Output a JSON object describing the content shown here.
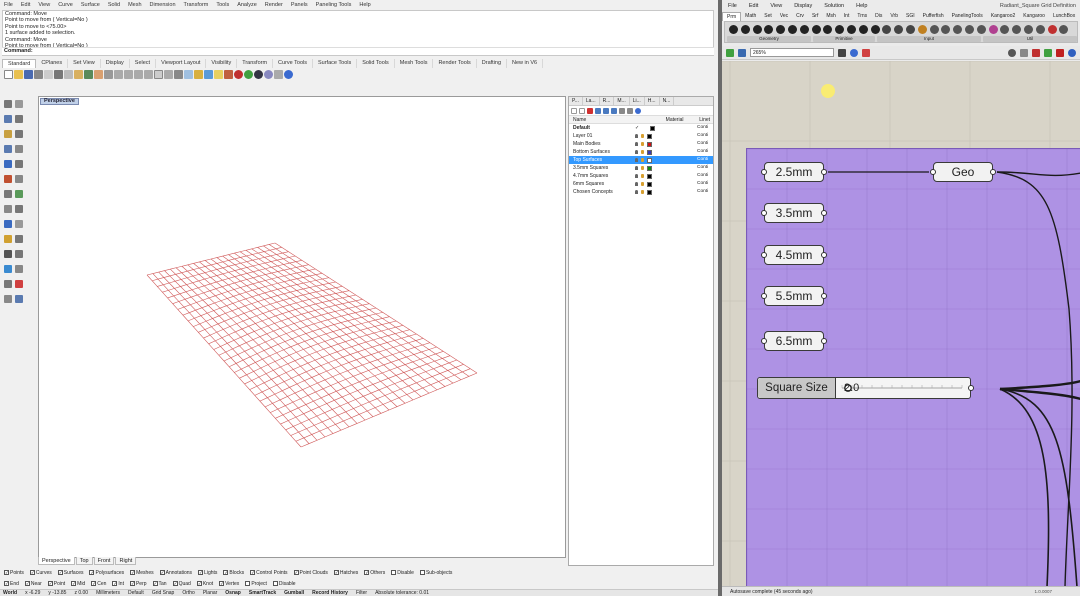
{
  "rhino": {
    "menu": [
      "File",
      "Edit",
      "View",
      "Curve",
      "Surface",
      "Solid",
      "Mesh",
      "Dimension",
      "Transform",
      "Tools",
      "Analyze",
      "Render",
      "Panels",
      "Paneling Tools",
      "Help"
    ],
    "command_history": [
      "Command: Move",
      "Point to move from ( Vertical=No )",
      "Point to move to <75.00>",
      "1 surface added to selection.",
      "Command: Move",
      "Point to move from ( Vertical=No )"
    ],
    "command_prompt": "Command:",
    "toolbar_tabs": [
      "Standard",
      "CPlanes",
      "Set View",
      "Display",
      "Select",
      "Viewport Layout",
      "Visibility",
      "Transform",
      "Curve Tools",
      "Surface Tools",
      "Solid Tools",
      "Mesh Tools",
      "Render Tools",
      "Drafting",
      "New in V6"
    ],
    "viewport_title": "Perspective",
    "viewport_tabs": [
      "Perspective",
      "Top",
      "Front",
      "Right"
    ],
    "layers": {
      "tab_labels": [
        "P...",
        "La...",
        "R...",
        "M...",
        "Li...",
        "H...",
        "N..."
      ],
      "header": {
        "name": "Name",
        "material": "Material",
        "linetype": "Linet"
      },
      "rows": [
        {
          "name": "Default",
          "color": "#000000",
          "linetype": "Conti",
          "current": true
        },
        {
          "name": "Layer 01",
          "color": "#000000",
          "linetype": "Conti"
        },
        {
          "name": "Main Bodies",
          "color": "#cc1111",
          "linetype": "Conti"
        },
        {
          "name": "Bottom Surfaces",
          "color": "#3a3ab0",
          "linetype": "Conti"
        },
        {
          "name": "Top Surfaces",
          "color": "#ffffff",
          "linetype": "Conti",
          "selected": true
        },
        {
          "name": "3.5mm Squares",
          "color": "#118811",
          "linetype": "Conti"
        },
        {
          "name": "4.7mm Squares",
          "color": "#000000",
          "linetype": "Conti"
        },
        {
          "name": "6mm Squares",
          "color": "#000000",
          "linetype": "Conti"
        },
        {
          "name": "Chosen Concepts",
          "color": "#000000",
          "linetype": "Conti"
        }
      ]
    },
    "filters_row1": [
      {
        "label": "Points",
        "checked": true
      },
      {
        "label": "Curves",
        "checked": true
      },
      {
        "label": "Surfaces",
        "checked": true
      },
      {
        "label": "Polysurfaces",
        "checked": true
      },
      {
        "label": "Meshes",
        "checked": true
      },
      {
        "label": "Annotations",
        "checked": true
      },
      {
        "label": "Lights",
        "checked": true
      },
      {
        "label": "Blocks",
        "checked": true
      },
      {
        "label": "Control Points",
        "checked": true
      },
      {
        "label": "Point Clouds",
        "checked": true
      },
      {
        "label": "Hatches",
        "checked": true
      },
      {
        "label": "Others",
        "checked": true
      },
      {
        "label": "Disable",
        "checked": false
      },
      {
        "label": "Sub-objects",
        "checked": false
      }
    ],
    "filters_row2": [
      {
        "label": "End",
        "checked": true
      },
      {
        "label": "Near",
        "checked": true
      },
      {
        "label": "Point",
        "checked": true
      },
      {
        "label": "Mid",
        "checked": true
      },
      {
        "label": "Cen",
        "checked": true
      },
      {
        "label": "Int",
        "checked": true
      },
      {
        "label": "Perp",
        "checked": true
      },
      {
        "label": "Tan",
        "checked": true
      },
      {
        "label": "Quad",
        "checked": true
      },
      {
        "label": "Knot",
        "checked": true
      },
      {
        "label": "Vertex",
        "checked": true
      },
      {
        "label": "Project",
        "checked": false
      },
      {
        "label": "Disable",
        "checked": false
      }
    ],
    "status": {
      "cplane": "World",
      "x": "x -6.29",
      "y": "y -13.85",
      "z": "z 0.00",
      "units": "Millimeters",
      "layer": "Default",
      "grid_snap": "Grid Snap",
      "ortho": "Ortho",
      "planar": "Planar",
      "osnap": "Osnap",
      "smarttrack": "SmartTrack",
      "gumball": "Gumball",
      "record_history": "Record History",
      "filter": "Filter",
      "tolerance": "Absolute tolerance: 0.01"
    }
  },
  "grasshopper": {
    "menu": [
      "File",
      "Edit",
      "View",
      "Display",
      "Solution",
      "Help"
    ],
    "title": "Radiant_Square Grid Definition",
    "tabs": [
      "Prm",
      "Math",
      "Set",
      "Vec",
      "Crv",
      "Srf",
      "Msh",
      "Int",
      "Trns",
      "Dis",
      "Vrb",
      "SGI",
      "Pufferfish",
      "PanelingTools",
      "Kangaroo2",
      "Kangaroo",
      "LunchBox"
    ],
    "ribbon_groups": [
      "Geometry",
      "Primitive",
      "Input",
      "Util"
    ],
    "zoom": "265%",
    "panels": [
      "2.5mm",
      "3.5mm",
      "4.5mm",
      "5.5mm",
      "6.5mm"
    ],
    "geo_label": "Geo",
    "slider": {
      "label": "Square Size",
      "value": "2.0"
    },
    "status": "Autosave complete (45 seconds ago)",
    "version": "1.0.0007"
  }
}
